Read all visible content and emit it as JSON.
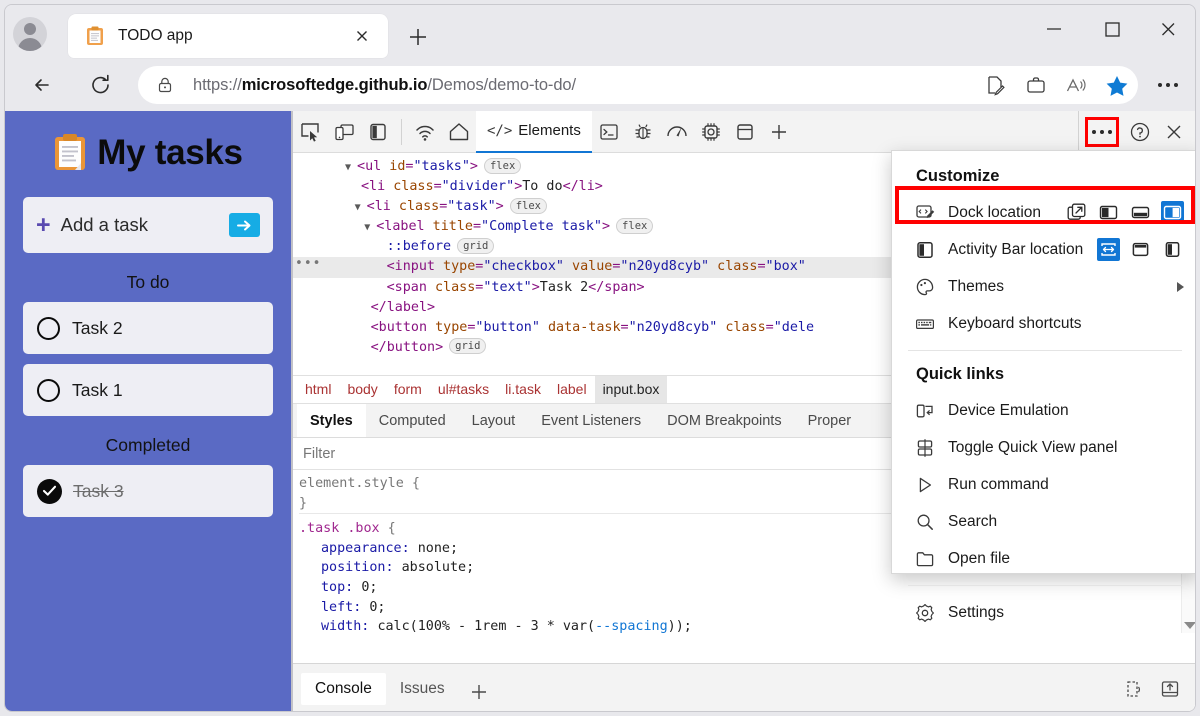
{
  "browser": {
    "tab": {
      "title": "TODO app",
      "favicon": "clipboard-icon",
      "close": "×"
    },
    "new_tab_label": "+",
    "url_prefix": "https://",
    "url_domain": "microsoftedge.github.io",
    "url_path": "/Demos/demo-to-do/",
    "omnibox_icons": [
      "read-aloud-icon",
      "collections-icon",
      "split-screen-icon",
      "favorite-star-icon"
    ],
    "window_controls": {
      "minimize": "−",
      "maximize": "□",
      "close": "✕"
    },
    "settings_more": "…"
  },
  "todo_app": {
    "title": "My tasks",
    "icon": "clipboard-icon",
    "add_task_placeholder": "Add a task",
    "add_plus": "+",
    "submit_arrow": "➡",
    "sections": [
      {
        "label": "To do",
        "tasks": [
          {
            "text": "Task 2",
            "done": false
          },
          {
            "text": "Task 1",
            "done": false
          }
        ]
      },
      {
        "label": "Completed",
        "tasks": [
          {
            "text": "Task 3",
            "done": true
          }
        ]
      }
    ]
  },
  "devtools": {
    "toolbar": {
      "left_icons": [
        "inspect-element-icon",
        "device-emulation-icon",
        "activity-bar-icon"
      ],
      "nav_icons": [
        "network-icon",
        "home-icon"
      ],
      "active_tab": "Elements",
      "active_tab_icon": "code-icon",
      "right_tool_icons": [
        "console-icon",
        "debugger-icon",
        "performance-icon",
        "settings-gear-icon",
        "application-icon"
      ],
      "add_tab": "+",
      "more_tools": "…",
      "help": "?",
      "close": "✕"
    },
    "dom_tree": [
      {
        "indent": 3,
        "arrow": "▼",
        "parts": [
          {
            "t": "tag",
            "v": "<ul"
          },
          {
            "t": "sp",
            "v": " "
          },
          {
            "t": "attr",
            "v": "id"
          },
          {
            "t": "tag",
            "v": "="
          },
          {
            "t": "val",
            "v": "\"tasks\""
          },
          {
            "t": "tag",
            "v": ">"
          }
        ],
        "badge": "flex",
        "selected": false
      },
      {
        "indent": 4,
        "arrow": "",
        "parts": [
          {
            "t": "tag",
            "v": "<li"
          },
          {
            "t": "sp",
            "v": " "
          },
          {
            "t": "attr",
            "v": "class"
          },
          {
            "t": "tag",
            "v": "="
          },
          {
            "t": "val",
            "v": "\"divider\""
          },
          {
            "t": "tag",
            "v": ">"
          },
          {
            "t": "txt",
            "v": "To do"
          },
          {
            "t": "tag",
            "v": "</li>"
          }
        ],
        "badge": "",
        "selected": false
      },
      {
        "indent": 3.6,
        "arrow": "▼",
        "parts": [
          {
            "t": "tag",
            "v": "<li"
          },
          {
            "t": "sp",
            "v": " "
          },
          {
            "t": "attr",
            "v": "class"
          },
          {
            "t": "tag",
            "v": "="
          },
          {
            "t": "val",
            "v": "\"task\""
          },
          {
            "t": "tag",
            "v": ">"
          }
        ],
        "badge": "flex",
        "selected": false
      },
      {
        "indent": 4.2,
        "arrow": "▼",
        "parts": [
          {
            "t": "tag",
            "v": "<label"
          },
          {
            "t": "sp",
            "v": " "
          },
          {
            "t": "attr",
            "v": "title"
          },
          {
            "t": "tag",
            "v": "="
          },
          {
            "t": "val",
            "v": "\"Complete task\""
          },
          {
            "t": "tag",
            "v": ">"
          }
        ],
        "badge": "flex",
        "selected": false
      },
      {
        "indent": 5.6,
        "arrow": "",
        "parts": [
          {
            "t": "val",
            "v": "::before"
          }
        ],
        "badge": "grid",
        "selected": false
      },
      {
        "indent": 5.6,
        "arrow": "",
        "parts": [
          {
            "t": "tag",
            "v": "<input"
          },
          {
            "t": "sp",
            "v": " "
          },
          {
            "t": "attr",
            "v": "type"
          },
          {
            "t": "tag",
            "v": "="
          },
          {
            "t": "val",
            "v": "\"checkbox\""
          },
          {
            "t": "sp",
            "v": " "
          },
          {
            "t": "attr",
            "v": "value"
          },
          {
            "t": "tag",
            "v": "="
          },
          {
            "t": "val",
            "v": "\"n20yd8cyb\""
          },
          {
            "t": "sp",
            "v": " "
          },
          {
            "t": "attr",
            "v": "class"
          },
          {
            "t": "tag",
            "v": "="
          },
          {
            "t": "val",
            "v": "\"box\""
          }
        ],
        "badge": "",
        "selected": true,
        "gutter": "•••"
      },
      {
        "indent": 5.6,
        "arrow": "",
        "parts": [
          {
            "t": "tag",
            "v": "<span"
          },
          {
            "t": "sp",
            "v": " "
          },
          {
            "t": "attr",
            "v": "class"
          },
          {
            "t": "tag",
            "v": "="
          },
          {
            "t": "val",
            "v": "\"text\""
          },
          {
            "t": "tag",
            "v": ">"
          },
          {
            "t": "txt",
            "v": "Task 2"
          },
          {
            "t": "tag",
            "v": "</span>"
          }
        ],
        "badge": "",
        "selected": false
      },
      {
        "indent": 4.6,
        "arrow": "",
        "parts": [
          {
            "t": "tag",
            "v": "</label>"
          }
        ],
        "badge": "",
        "selected": false
      },
      {
        "indent": 4.6,
        "arrow": "",
        "parts": [
          {
            "t": "tag",
            "v": "<button"
          },
          {
            "t": "sp",
            "v": " "
          },
          {
            "t": "attr",
            "v": "type"
          },
          {
            "t": "tag",
            "v": "="
          },
          {
            "t": "val",
            "v": "\"button\""
          },
          {
            "t": "sp",
            "v": " "
          },
          {
            "t": "attr",
            "v": "data-task"
          },
          {
            "t": "tag",
            "v": "="
          },
          {
            "t": "val",
            "v": "\"n20yd8cyb\""
          },
          {
            "t": "sp",
            "v": " "
          },
          {
            "t": "attr",
            "v": "class"
          },
          {
            "t": "tag",
            "v": "="
          },
          {
            "t": "val",
            "v": "\"dele"
          }
        ],
        "badge": "",
        "selected": false
      },
      {
        "indent": 4.6,
        "arrow": "",
        "parts": [
          {
            "t": "tag",
            "v": "</button>"
          }
        ],
        "badge": "grid",
        "selected": false
      }
    ],
    "breadcrumb": [
      "html",
      "body",
      "form",
      "ul#tasks",
      "li.task",
      "label",
      "input.box"
    ],
    "breadcrumb_active": "input.box",
    "panel_tabs": [
      "Styles",
      "Computed",
      "Layout",
      "Event Listeners",
      "DOM Breakpoints",
      "Proper"
    ],
    "panel_tab_active": "Styles",
    "filter_placeholder": "Filter",
    "css_rules": [
      {
        "selector": "element.style",
        "open": " {",
        "close": "}",
        "declarations": []
      },
      {
        "selector": ".task .box",
        "open": " {",
        "close": "",
        "declarations": [
          {
            "prop": "appearance",
            "value": "none;"
          },
          {
            "prop": "position",
            "value": "absolute;"
          },
          {
            "prop": "top",
            "value": "0;"
          },
          {
            "prop": "left",
            "value": "0;"
          },
          {
            "prop": "width",
            "value": "calc(100% - 1rem - 3 * var(--spacing));",
            "var_token": "--spacing"
          }
        ]
      }
    ],
    "drawer_tabs": [
      "Console",
      "Issues"
    ],
    "drawer_tab_active": "Console",
    "drawer_add": "+",
    "drawer_right_icons": [
      "network-conditions-icon",
      "restore-drawer-icon"
    ]
  },
  "customize_menu": {
    "heading_customize": "Customize",
    "items": [
      {
        "label": "Dock location",
        "icon": "dock-location-icon",
        "choices": [
          "undock-icon",
          "dock-left-icon",
          "dock-bottom-icon",
          "dock-right-icon"
        ],
        "selected_choice": 3,
        "highlighted": true
      },
      {
        "label": "Activity Bar location",
        "icon": "activity-bar-icon",
        "choices": [
          "activity-bar-horizontal-icon",
          "activity-bar-top-icon",
          "activity-bar-left-icon"
        ],
        "selected_choice": 0,
        "highlighted": false
      },
      {
        "label": "Themes",
        "icon": "palette-icon",
        "submenu": "▶",
        "highlighted": false
      },
      {
        "label": "Keyboard shortcuts",
        "icon": "keyboard-icon",
        "highlighted": false
      }
    ],
    "heading_quicklinks": "Quick links",
    "quick_links": [
      {
        "label": "Device Emulation",
        "icon": "device-emulation-icon"
      },
      {
        "label": "Toggle Quick View panel",
        "icon": "quick-view-icon"
      },
      {
        "label": "Run command",
        "icon": "play-icon"
      },
      {
        "label": "Search",
        "icon": "search-icon"
      },
      {
        "label": "Open file",
        "icon": "folder-icon"
      }
    ],
    "settings": {
      "label": "Settings",
      "icon": "gear-icon"
    }
  },
  "colors": {
    "todo_purple": "#5a6ac4",
    "accent_blue": "#1176d4",
    "highlight_red": "#ff0000",
    "submit_cyan": "#16ace5",
    "favorite_star": "#0f7bd4"
  }
}
